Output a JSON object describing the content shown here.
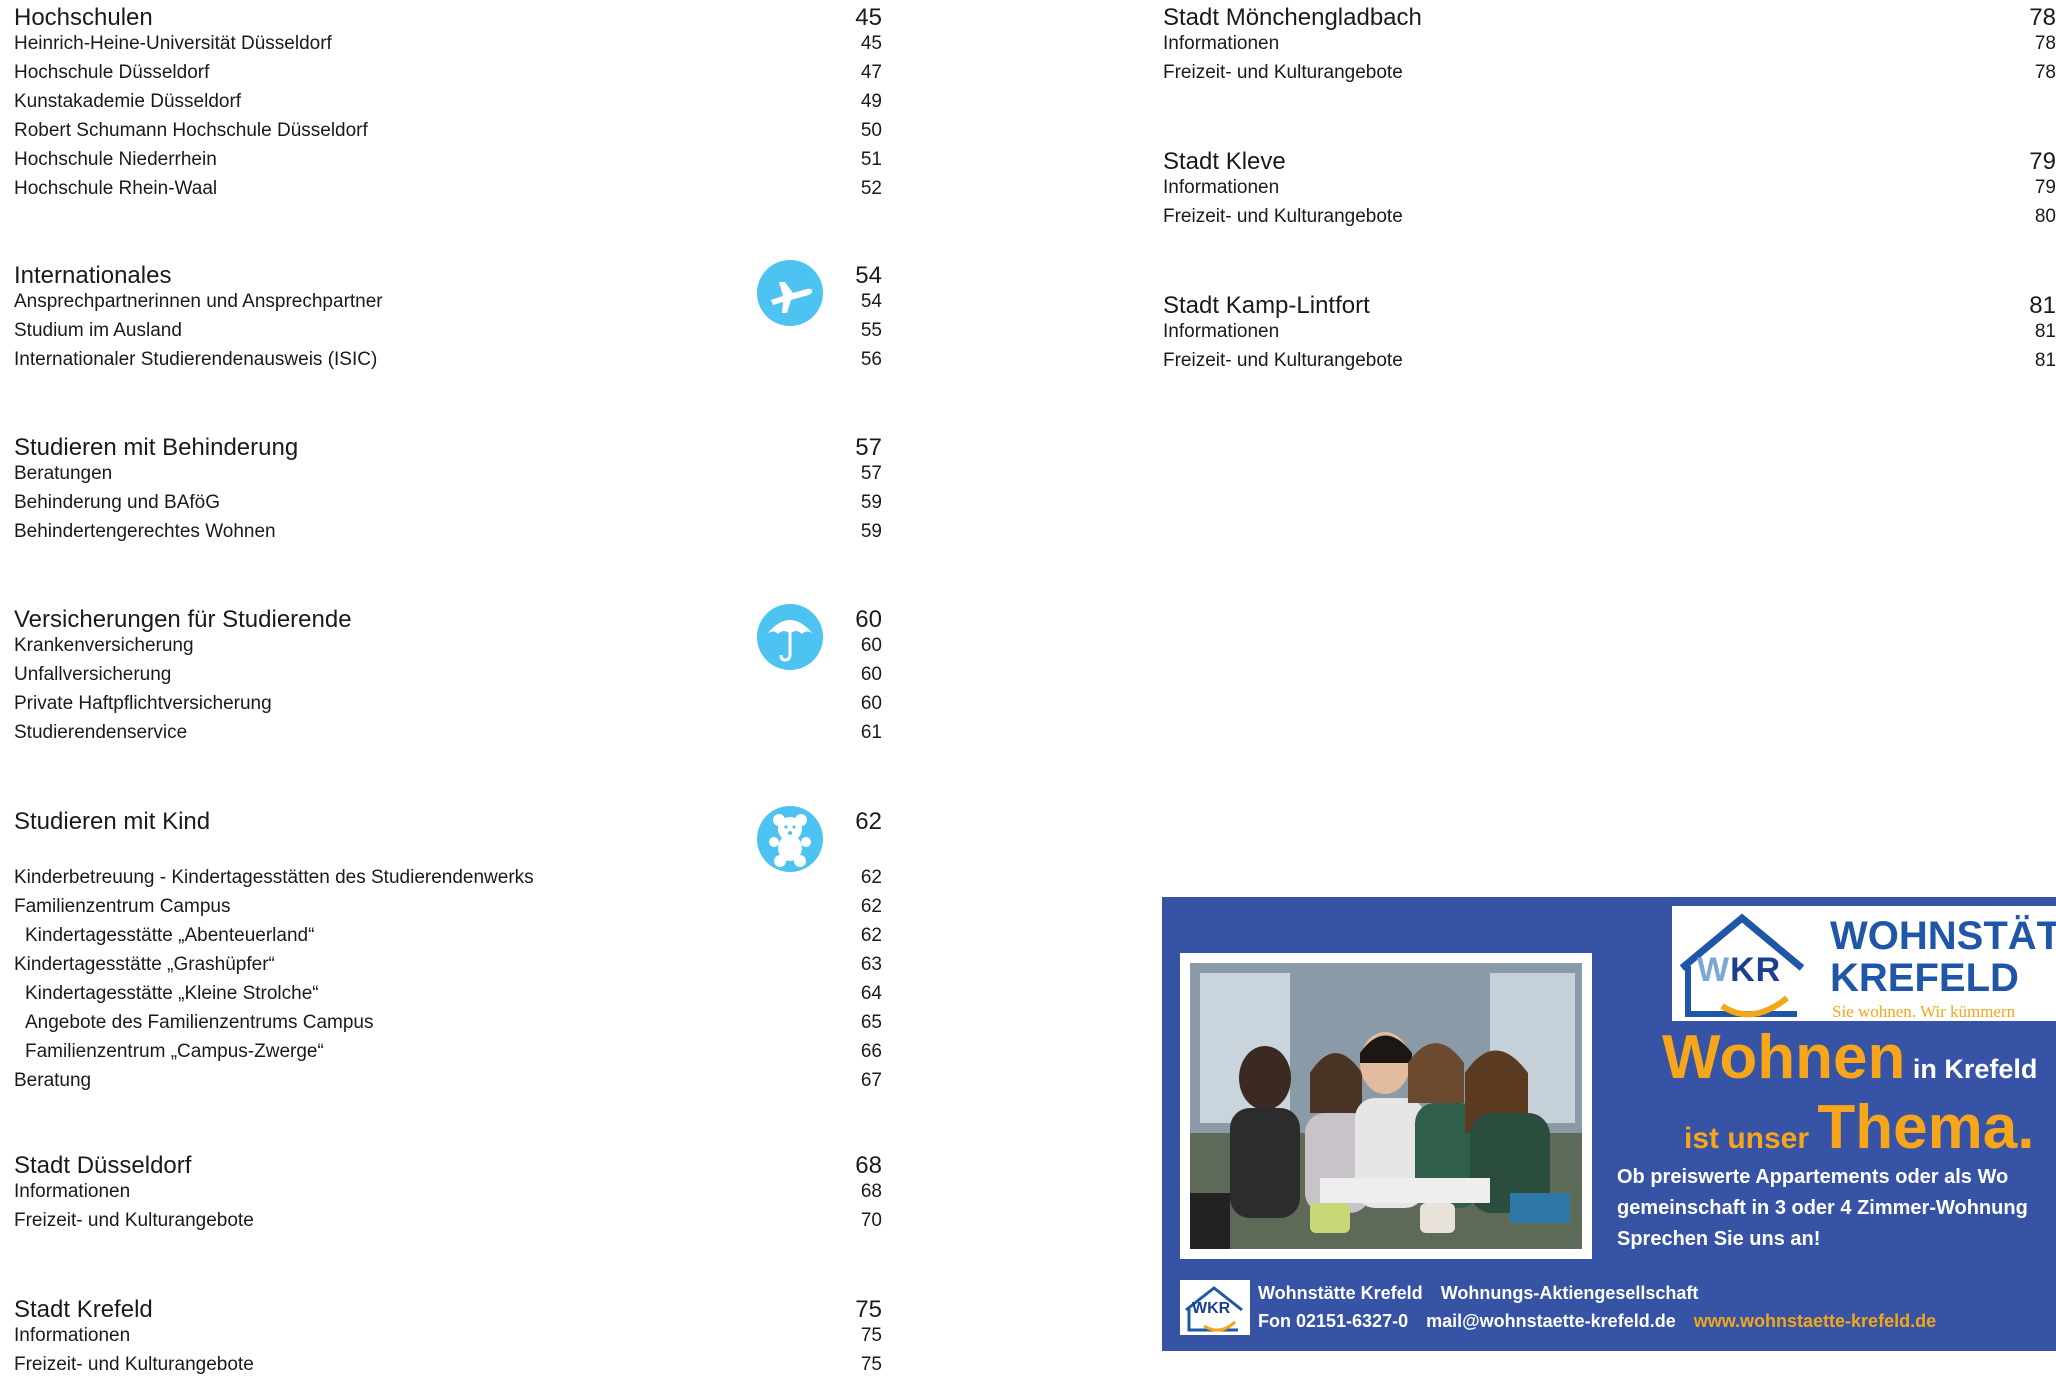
{
  "left_sections": [
    {
      "title": "Hochschulen",
      "page": "45",
      "items": [
        {
          "label": "Heinrich-Heine-Universität Düsseldorf",
          "page": "45"
        },
        {
          "label": "Hochschule Düsseldorf",
          "page": "47"
        },
        {
          "label": "Kunstakademie Düsseldorf",
          "page": "49"
        },
        {
          "label": "Robert Schumann Hochschule Düsseldorf",
          "page": "50"
        },
        {
          "label": "Hochschule Niederrhein",
          "page": "51"
        },
        {
          "label": "Hochschule Rhein-Waal",
          "page": "52"
        }
      ]
    },
    {
      "title": "Internationales",
      "page": "54",
      "icon": "airplane-icon",
      "items": [
        {
          "label": "Ansprechpartnerinnen und Ansprechpartner",
          "page": "54"
        },
        {
          "label": "Studium im Ausland",
          "page": "55"
        },
        {
          "label": "Internationaler Studierendenausweis (ISIC)",
          "page": "56"
        }
      ]
    },
    {
      "title": "Studieren mit Behinderung",
      "page": "57",
      "items": [
        {
          "label": "Beratungen",
          "page": "57"
        },
        {
          "label": "Behinderung und BAföG",
          "page": "59"
        },
        {
          "label": "Behindertengerechtes Wohnen",
          "page": "59"
        }
      ]
    },
    {
      "title": "Versicherungen für Studierende",
      "page": "60",
      "icon": "umbrella-icon",
      "items": [
        {
          "label": "Krankenversicherung",
          "page": "60"
        },
        {
          "label": "Unfallversicherung",
          "page": "60"
        },
        {
          "label": "Private Haftpflichtversicherung",
          "page": "60"
        },
        {
          "label": "Studierendenservice",
          "page": "61"
        }
      ]
    },
    {
      "title": "Studieren mit Kind",
      "page": "62",
      "icon": "teddy-bear-icon",
      "items": [
        {
          "label": "Kinderbetreuung - Kindertagesstätten des Studierendenwerks",
          "page": "62"
        },
        {
          "label": "Familienzentrum Campus",
          "page": "62"
        },
        {
          "label": "Kindertagesstätte „Abenteuerland“",
          "page": "62",
          "indent": true
        },
        {
          "label": "Kindertagesstätte „Grashüpfer“",
          "page": "63"
        },
        {
          "label": "Kindertagesstätte „Kleine Strolche“",
          "page": "64",
          "indent": true
        },
        {
          "label": "Angebote des Familienzentrums Campus",
          "page": "65",
          "indent": true
        },
        {
          "label": "Familienzentrum „Campus-Zwerge“",
          "page": "66",
          "indent": true
        },
        {
          "label": "Beratung",
          "page": "67"
        }
      ]
    },
    {
      "title": "Stadt Düsseldorf",
      "page": "68",
      "items": [
        {
          "label": "Informationen",
          "page": "68"
        },
        {
          "label": "Freizeit- und Kulturangebote",
          "page": "70"
        }
      ]
    },
    {
      "title": "Stadt Krefeld",
      "page": "75",
      "items": [
        {
          "label": "Informationen",
          "page": "75"
        },
        {
          "label": "Freizeit- und Kulturangebote",
          "page": "75"
        }
      ]
    }
  ],
  "right_sections": [
    {
      "title": "Stadt Mönchengladbach",
      "page": "78",
      "items": [
        {
          "label": "Informationen",
          "page": "78"
        },
        {
          "label": "Freizeit- und Kulturangebote",
          "page": "78"
        }
      ]
    },
    {
      "title": "Stadt Kleve",
      "page": "79",
      "items": [
        {
          "label": "Informationen",
          "page": "79"
        },
        {
          "label": "Freizeit- und Kulturangebote",
          "page": "80"
        }
      ]
    },
    {
      "title": "Stadt Kamp-Lintfort",
      "page": "81",
      "items": [
        {
          "label": "Informationen",
          "page": "81"
        },
        {
          "label": "Freizeit- und Kulturangebote",
          "page": "81"
        }
      ]
    }
  ],
  "ad": {
    "logo_abbr": "WKR",
    "logo_line1": "WOHNSTÄT",
    "logo_line2": "KREFELD",
    "slogan": "Sie wohnen. Wir kümmern",
    "headline_big1": "Wohnen",
    "headline_small1": " in Krefeld",
    "headline_small2": "ist unser ",
    "headline_big2": "Thema.",
    "body_line1": "Ob preiswerte Appartements oder als Wo",
    "body_line2": "gemeinschaft  in 3 oder 4 Zimmer-Wohnung",
    "body_line3": "Sprechen Sie uns an!",
    "footer_logo": "WKR",
    "footer_company": "Wohnstätte Krefeld",
    "footer_company2": "Wohnungs-Aktiengesellschaft",
    "footer_phone": "Fon 02151-6327-0",
    "footer_mail": "mail@wohnstaette-krefeld.de",
    "footer_web": "www.wohnstaette-krefeld.de"
  }
}
